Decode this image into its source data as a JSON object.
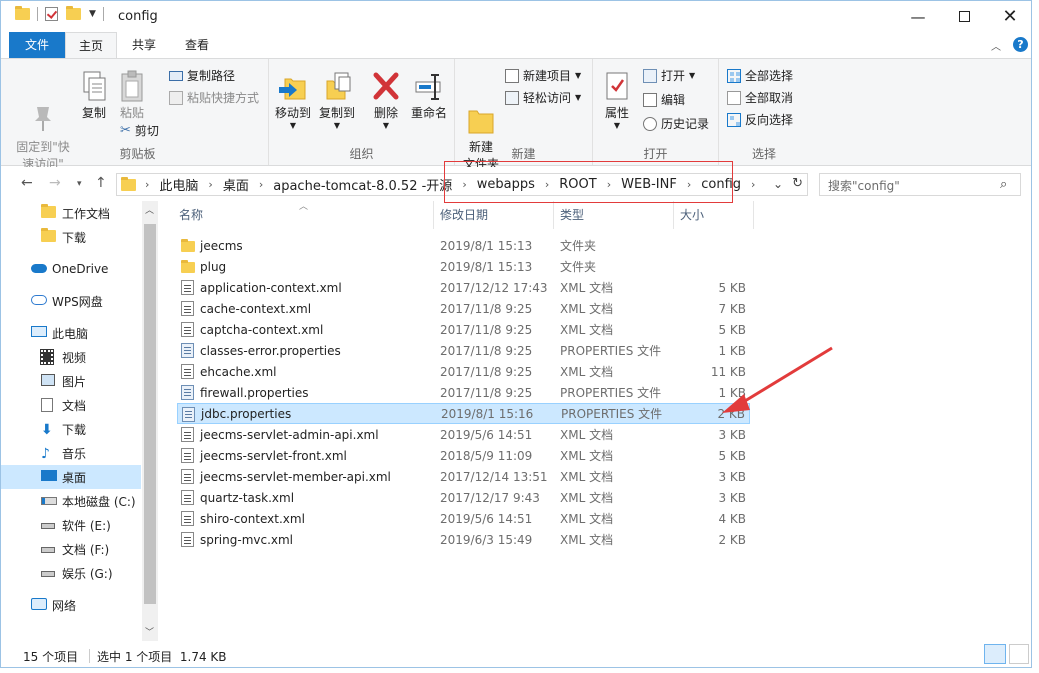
{
  "window": {
    "title": "config"
  },
  "menu": {
    "tabs": [
      "文件",
      "主页",
      "共享",
      "查看"
    ]
  },
  "ribbon": {
    "clipboard": {
      "pin": "固定到\"快\n速访问\"",
      "copy": "复制",
      "paste": "粘贴",
      "copy_path": "复制路径",
      "paste_shortcut": "粘贴快捷方式",
      "cut": "剪切",
      "label": "剪贴板"
    },
    "organize": {
      "move_to": "移动到",
      "copy_to": "复制到",
      "delete": "删除",
      "rename": "重命名",
      "label": "组织"
    },
    "new": {
      "new_folder": "新建\n文件夹",
      "new_item": "新建项目",
      "easy_access": "轻松访问",
      "label": "新建"
    },
    "open": {
      "properties": "属性",
      "open": "打开",
      "edit": "编辑",
      "history": "历史记录",
      "label": "打开"
    },
    "select": {
      "select_all": "全部选择",
      "select_none": "全部取消",
      "invert": "反向选择",
      "label": "选择"
    }
  },
  "address": {
    "crumbs": [
      "此电脑",
      "桌面",
      "apache-tomcat-8.0.52 -开源",
      "webapps",
      "ROOT",
      "WEB-INF",
      "config"
    ],
    "search_placeholder": "搜索\"config\""
  },
  "nav": {
    "items": [
      {
        "label": "工作文档",
        "icon": "folder-icon"
      },
      {
        "label": "下载",
        "icon": "folder-icon"
      },
      {
        "label": "OneDrive",
        "icon": "cloud-icon"
      },
      {
        "label": "WPS网盘",
        "icon": "cloud-outline-icon"
      },
      {
        "label": "此电脑",
        "icon": "computer-icon"
      },
      {
        "label": "视频",
        "icon": "video-icon"
      },
      {
        "label": "图片",
        "icon": "picture-icon"
      },
      {
        "label": "文档",
        "icon": "document-icon"
      },
      {
        "label": "下载",
        "icon": "download-icon"
      },
      {
        "label": "音乐",
        "icon": "music-icon"
      },
      {
        "label": "桌面",
        "icon": "desktop-icon"
      },
      {
        "label": "本地磁盘 (C:)",
        "icon": "system-drive-icon"
      },
      {
        "label": "软件 (E:)",
        "icon": "drive-icon"
      },
      {
        "label": "文档 (F:)",
        "icon": "drive-icon"
      },
      {
        "label": "娱乐 (G:)",
        "icon": "drive-icon"
      },
      {
        "label": "网络",
        "icon": "network-icon"
      }
    ]
  },
  "columns": {
    "name": "名称",
    "date": "修改日期",
    "type": "类型",
    "size": "大小"
  },
  "files": [
    {
      "name": "jeecms",
      "date": "2019/8/1 15:13",
      "type": "文件夹",
      "size": "",
      "icon": "folder"
    },
    {
      "name": "plug",
      "date": "2019/8/1 15:13",
      "type": "文件夹",
      "size": "",
      "icon": "folder"
    },
    {
      "name": "application-context.xml",
      "date": "2017/12/12 17:43",
      "type": "XML 文档",
      "size": "5 KB",
      "icon": "xml"
    },
    {
      "name": "cache-context.xml",
      "date": "2017/11/8 9:25",
      "type": "XML 文档",
      "size": "7 KB",
      "icon": "xml"
    },
    {
      "name": "captcha-context.xml",
      "date": "2017/11/8 9:25",
      "type": "XML 文档",
      "size": "5 KB",
      "icon": "xml"
    },
    {
      "name": "classes-error.properties",
      "date": "2017/11/8 9:25",
      "type": "PROPERTIES 文件",
      "size": "1 KB",
      "icon": "prop"
    },
    {
      "name": "ehcache.xml",
      "date": "2017/11/8 9:25",
      "type": "XML 文档",
      "size": "11 KB",
      "icon": "xml"
    },
    {
      "name": "firewall.properties",
      "date": "2017/11/8 9:25",
      "type": "PROPERTIES 文件",
      "size": "1 KB",
      "icon": "prop"
    },
    {
      "name": "jdbc.properties",
      "date": "2019/8/1 15:16",
      "type": "PROPERTIES 文件",
      "size": "2 KB",
      "icon": "prop",
      "selected": true
    },
    {
      "name": "jeecms-servlet-admin-api.xml",
      "date": "2019/5/6 14:51",
      "type": "XML 文档",
      "size": "3 KB",
      "icon": "xml"
    },
    {
      "name": "jeecms-servlet-front.xml",
      "date": "2018/5/9 11:09",
      "type": "XML 文档",
      "size": "5 KB",
      "icon": "xml"
    },
    {
      "name": "jeecms-servlet-member-api.xml",
      "date": "2017/12/14 13:51",
      "type": "XML 文档",
      "size": "3 KB",
      "icon": "xml"
    },
    {
      "name": "quartz-task.xml",
      "date": "2017/12/17 9:43",
      "type": "XML 文档",
      "size": "3 KB",
      "icon": "xml"
    },
    {
      "name": "shiro-context.xml",
      "date": "2019/5/6 14:51",
      "type": "XML 文档",
      "size": "4 KB",
      "icon": "xml"
    },
    {
      "name": "spring-mvc.xml",
      "date": "2019/6/3 15:49",
      "type": "XML 文档",
      "size": "2 KB",
      "icon": "xml"
    }
  ],
  "status": {
    "count": "15 个项目",
    "selection": "选中 1 个项目  1.74 KB"
  },
  "colors": {
    "accent": "#1979ca",
    "selection": "#cce8ff",
    "highlight_box": "#e23b3b",
    "arrow": "#e23b3b"
  }
}
